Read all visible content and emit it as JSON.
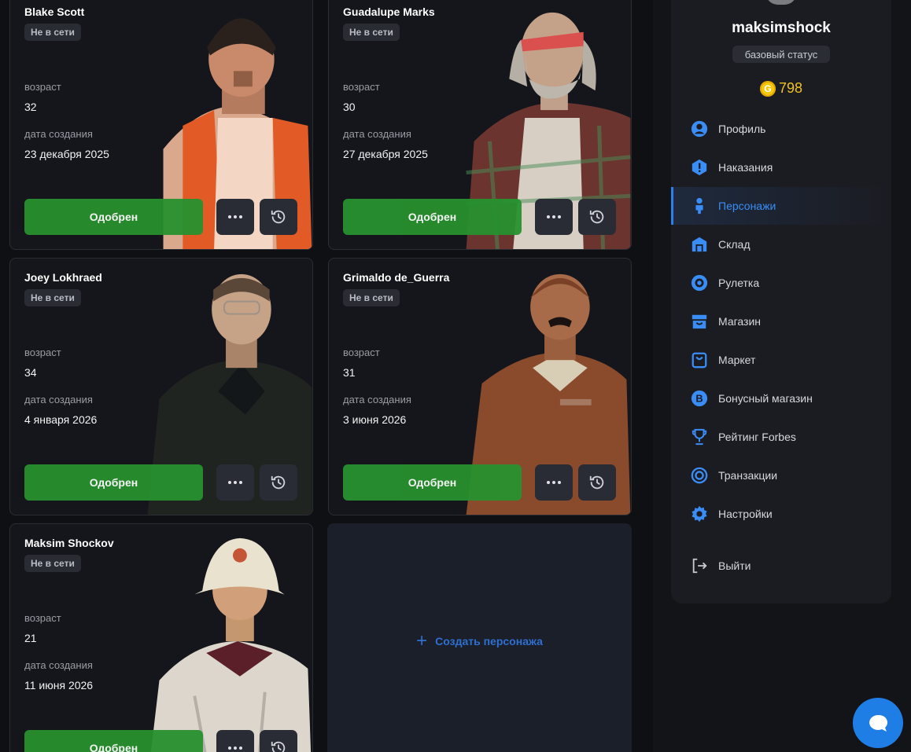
{
  "characters": [
    {
      "name": "Blake Scott",
      "status": "Не в сети",
      "age_label": "возраст",
      "age": "32",
      "created_label": "дата создания",
      "created": "23 декабря 2025",
      "approve": "Одобрен"
    },
    {
      "name": "Guadalupe Marks",
      "status": "Не в сети",
      "age_label": "возраст",
      "age": "30",
      "created_label": "дата создания",
      "created": "27 декабря 2025",
      "approve": "Одобрен"
    },
    {
      "name": "Joey Lokhraed",
      "status": "Не в сети",
      "age_label": "возраст",
      "age": "34",
      "created_label": "дата создания",
      "created": "4 января 2026",
      "approve": "Одобрен"
    },
    {
      "name": "Grimaldo de_Guerra",
      "status": "Не в сети",
      "age_label": "возраст",
      "age": "31",
      "created_label": "дата создания",
      "created": "3 июня 2026",
      "approve": "Одобрен"
    },
    {
      "name": "Maksim Shockov",
      "status": "Не в сети",
      "age_label": "возраст",
      "age": "21",
      "created_label": "дата создания",
      "created": "11 июня 2026",
      "approve": "Одобрен"
    }
  ],
  "create_card": {
    "label": "Создать персонажа"
  },
  "profile": {
    "username": "maksimshock",
    "status": "базовый статус",
    "coins": "798",
    "coin_letter": "G"
  },
  "menu": [
    {
      "label": "Профиль",
      "icon": "user-circle-icon"
    },
    {
      "label": "Наказания",
      "icon": "warning-hexagon-icon"
    },
    {
      "label": "Персонажи",
      "icon": "person-icon",
      "active": true
    },
    {
      "label": "Склад",
      "icon": "warehouse-icon"
    },
    {
      "label": "Рулетка",
      "icon": "roulette-icon"
    },
    {
      "label": "Магазин",
      "icon": "store-icon"
    },
    {
      "label": "Маркет",
      "icon": "shopping-bag-icon"
    },
    {
      "label": "Бонусный магазин",
      "icon": "bonus-b-icon"
    },
    {
      "label": "Рейтинг Forbes",
      "icon": "trophy-icon"
    },
    {
      "label": "Транзакции",
      "icon": "coin-transfer-icon"
    },
    {
      "label": "Настройки",
      "icon": "gear-icon"
    }
  ],
  "logout": {
    "label": "Выйти",
    "icon": "logout-icon"
  },
  "colors": {
    "accent": "#2f7ef0",
    "approve": "#27912f",
    "coin": "#f6c90e",
    "panel": "#1b1c22"
  }
}
